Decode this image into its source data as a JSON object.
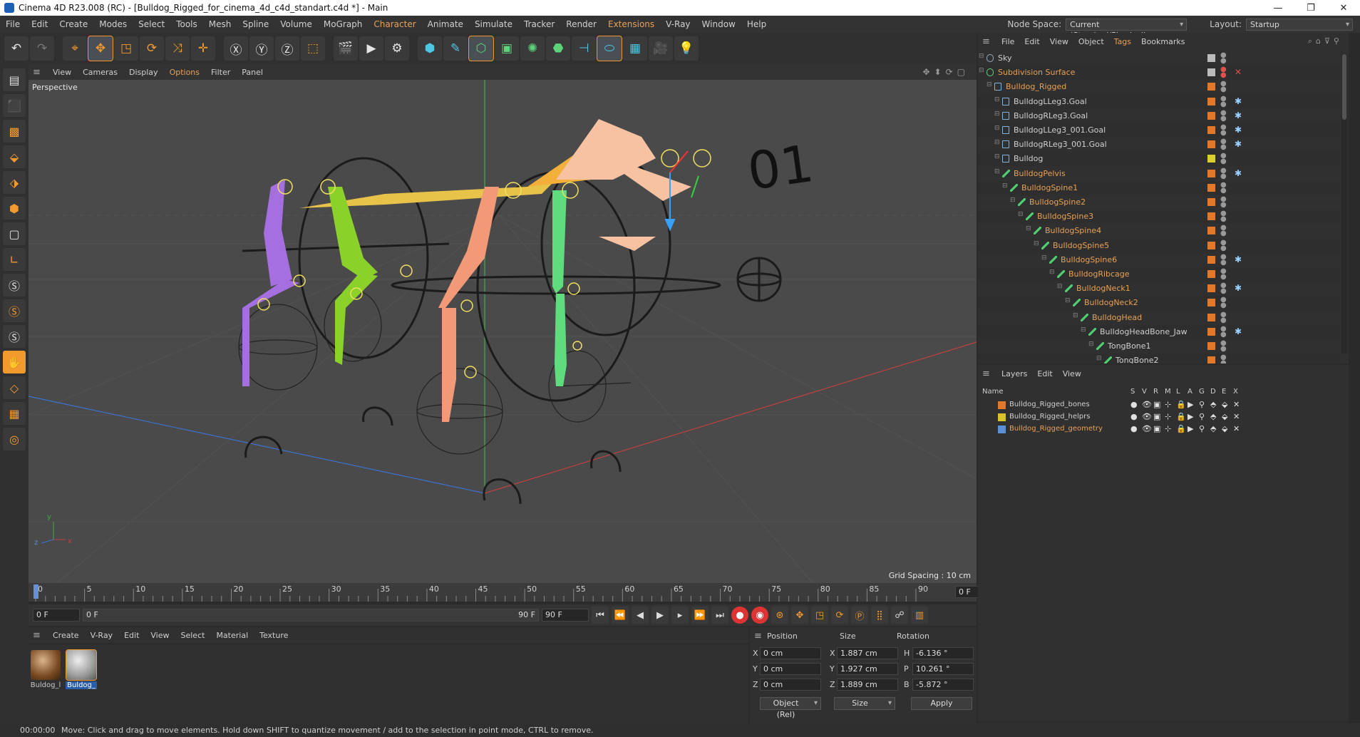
{
  "window": {
    "title": "Cinema 4D R23.008 (RC) - [Bulldog_Rigged_for_cinema_4d_c4d_standart.c4d *] - Main",
    "minimize": "—",
    "restore": "❐",
    "close": "✕"
  },
  "menubar": {
    "items": [
      "File",
      "Edit",
      "Create",
      "Modes",
      "Select",
      "Tools",
      "Mesh",
      "Spline",
      "Volume",
      "MoGraph",
      "Character",
      "Animate",
      "Simulate",
      "Tracker",
      "Render",
      "Extensions",
      "V-Ray",
      "Window",
      "Help"
    ],
    "node_space_label": "Node Space:",
    "node_space_value": "Current (Standard/Physical)",
    "layout_label": "Layout:",
    "layout_value": "Startup"
  },
  "viewport": {
    "menu": [
      "View",
      "Cameras",
      "Display",
      "Options",
      "Filter",
      "Panel"
    ],
    "label": "Perspective",
    "grid_spacing": "Grid Spacing : 10 cm",
    "axis_y": "y",
    "axis_z": "z",
    "axis_x": "x",
    "model_text": "01"
  },
  "timeline": {
    "ticks": [
      "0",
      "5",
      "10",
      "15",
      "20",
      "25",
      "30",
      "35",
      "40",
      "45",
      "50",
      "55",
      "60",
      "65",
      "70",
      "75",
      "80",
      "85",
      "90"
    ],
    "current_frame": "0 F",
    "start_field": "0 F",
    "range_start": "0 F",
    "range_end": "90 F",
    "end_field": "90 F"
  },
  "materials": {
    "menu": [
      "Create",
      "V-Ray",
      "Edit",
      "View",
      "Select",
      "Material",
      "Texture"
    ],
    "items": [
      {
        "name": "Buldog_l",
        "selected": false
      },
      {
        "name": "Buldog_",
        "selected": true
      }
    ]
  },
  "coordinates": {
    "headers": {
      "position": "Position",
      "size": "Size",
      "rotation": "Rotation"
    },
    "rows": [
      {
        "axis": "X",
        "pos": "0 cm",
        "size_axis": "X",
        "size": "1.887 cm",
        "rot_axis": "H",
        "rot": "-6.136 °"
      },
      {
        "axis": "Y",
        "pos": "0 cm",
        "size_axis": "Y",
        "size": "1.927 cm",
        "rot_axis": "P",
        "rot": "10.261 °"
      },
      {
        "axis": "Z",
        "pos": "0 cm",
        "size_axis": "Z",
        "size": "1.889 cm",
        "rot_axis": "B",
        "rot": "-5.872 °"
      }
    ],
    "mode_dropdown": "Object (Rel)",
    "size_dropdown": "Size",
    "apply_button": "Apply"
  },
  "status": {
    "time": "00:00:00",
    "message": "Move: Click and drag to move elements. Hold down SHIFT to quantize movement / add to the selection in point mode, CTRL to remove."
  },
  "object_manager": {
    "menu": [
      "File",
      "Edit",
      "View",
      "Object",
      "Tags",
      "Bookmarks"
    ],
    "objects": [
      {
        "name": "Sky",
        "depth": 0,
        "kind": "sky",
        "color": "#cfcfcf"
      },
      {
        "name": "Subdivision Surface",
        "depth": 0,
        "kind": "subd",
        "color": "#e9a055"
      },
      {
        "name": "Bulldog_Rigged",
        "depth": 1,
        "kind": "null",
        "color": "#e9a055"
      },
      {
        "name": "BulldogLLeg3.Goal",
        "depth": 2,
        "kind": "null",
        "color": "#cfcfcf"
      },
      {
        "name": "BulldogRLeg3.Goal",
        "depth": 2,
        "kind": "null",
        "color": "#cfcfcf"
      },
      {
        "name": "BulldogLLeg3_001.Goal",
        "depth": 2,
        "kind": "null",
        "color": "#cfcfcf"
      },
      {
        "name": "BulldogRLeg3_001.Goal",
        "depth": 2,
        "kind": "null",
        "color": "#cfcfcf"
      },
      {
        "name": "Bulldog",
        "depth": 2,
        "kind": "null",
        "color": "#cfcfcf"
      },
      {
        "name": "BulldogPelvis",
        "depth": 2,
        "kind": "bone",
        "color": "#e9a055"
      },
      {
        "name": "BulldogSpine1",
        "depth": 3,
        "kind": "bone",
        "color": "#e9a055"
      },
      {
        "name": "BulldogSpine2",
        "depth": 4,
        "kind": "bone",
        "color": "#e9a055"
      },
      {
        "name": "BulldogSpine3",
        "depth": 5,
        "kind": "bone",
        "color": "#e9a055"
      },
      {
        "name": "BulldogSpine4",
        "depth": 6,
        "kind": "bone",
        "color": "#e9a055"
      },
      {
        "name": "BulldogSpine5",
        "depth": 7,
        "kind": "bone",
        "color": "#e9a055"
      },
      {
        "name": "BulldogSpine6",
        "depth": 8,
        "kind": "bone",
        "color": "#e9a055"
      },
      {
        "name": "BulldogRibcage",
        "depth": 9,
        "kind": "bone",
        "color": "#e9a055"
      },
      {
        "name": "BulldogNeck1",
        "depth": 10,
        "kind": "bone",
        "color": "#e9a055"
      },
      {
        "name": "BulldogNeck2",
        "depth": 11,
        "kind": "bone",
        "color": "#e9a055"
      },
      {
        "name": "BulldogHead",
        "depth": 12,
        "kind": "bone",
        "color": "#e9a055"
      },
      {
        "name": "BulldogHeadBone_Jaw",
        "depth": 13,
        "kind": "bone",
        "color": "#cfcfcf"
      },
      {
        "name": "TongBone1",
        "depth": 14,
        "kind": "bone",
        "color": "#cfcfcf"
      },
      {
        "name": "TongBone2",
        "depth": 15,
        "kind": "bone",
        "color": "#cfcfcf"
      }
    ]
  },
  "layers": {
    "menu": [
      "Layers",
      "Edit",
      "View"
    ],
    "columns": [
      "Name",
      "S",
      "V",
      "R",
      "M",
      "L",
      "A",
      "G",
      "D",
      "E",
      "X"
    ],
    "items": [
      {
        "name": "Bulldog_Rigged_bones",
        "color": "#e07a2a",
        "text_color": "#cfcfcf"
      },
      {
        "name": "Bulldog_Rigged_helprs",
        "color": "#d9c12e",
        "text_color": "#cfcfcf"
      },
      {
        "name": "Bulldog_Rigged_geometry",
        "color": "#5b8fd6",
        "text_color": "#e9a055"
      }
    ]
  },
  "colors": {
    "accent": "#f29a2e",
    "panel": "#303030",
    "viewport": "#4a4a4a"
  }
}
